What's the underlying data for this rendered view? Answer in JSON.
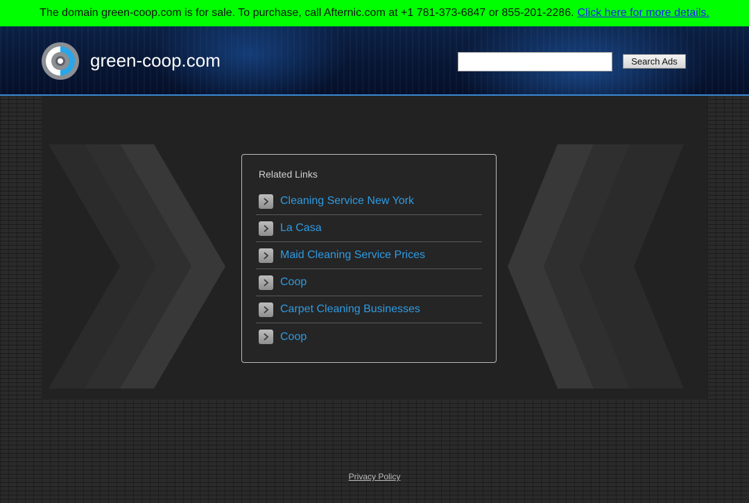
{
  "banner": {
    "text": "The domain green-coop.com is for sale. To purchase, call Afternic.com at +1 781-373-6847 or 855-201-2286.",
    "link_label": "Click here for more details.",
    "bg_color": "#00ff00",
    "link_color": "#1a1aff"
  },
  "header": {
    "site_title": "green-coop.com",
    "logo_icon": "target-logo-icon",
    "search": {
      "value": "",
      "placeholder": ""
    },
    "search_button_label": "Search Ads",
    "accent_color": "#3b8ad6"
  },
  "related": {
    "title": "Related Links",
    "chevron_icon": "chevron-right-icon",
    "link_color": "#2f9be3",
    "links": [
      {
        "label": "Cleaning Service New York"
      },
      {
        "label": "La Casa"
      },
      {
        "label": "Maid Cleaning Service Prices"
      },
      {
        "label": "Coop"
      },
      {
        "label": "Carpet Cleaning Businesses"
      },
      {
        "label": "Coop"
      }
    ]
  },
  "footer": {
    "privacy_label": "Privacy Policy"
  }
}
